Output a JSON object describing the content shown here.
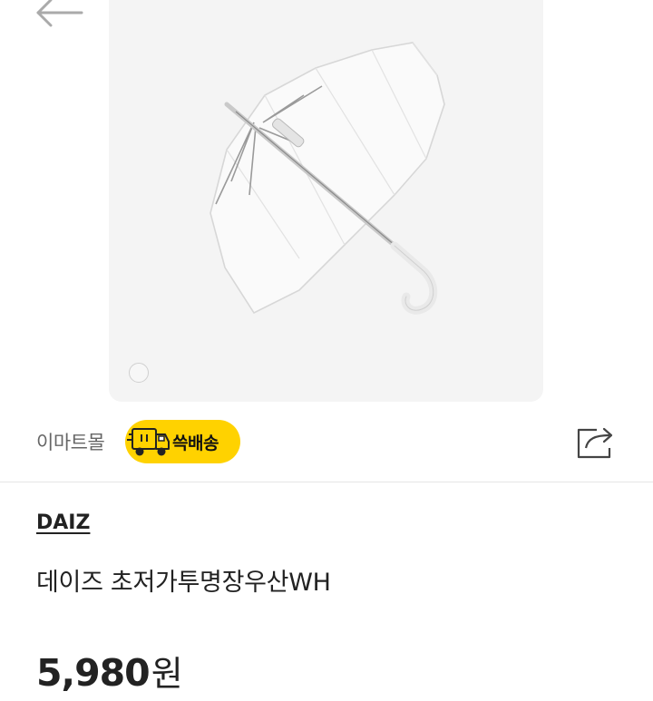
{
  "header": {
    "back_icon": "arrow-left-icon"
  },
  "product_image": {
    "subject": "umbrella-icon",
    "carousel_dot_icon": "circle-icon"
  },
  "seller": {
    "name": "이마트몰",
    "badge_label": "쓱배송",
    "badge_icon": "delivery-truck-icon",
    "badge_color": "#ffd200",
    "share_icon": "share-icon"
  },
  "product": {
    "brand": "DAIZ",
    "title": "데이즈 초저가투명장우산WH",
    "price": "5,980",
    "currency": "원"
  }
}
